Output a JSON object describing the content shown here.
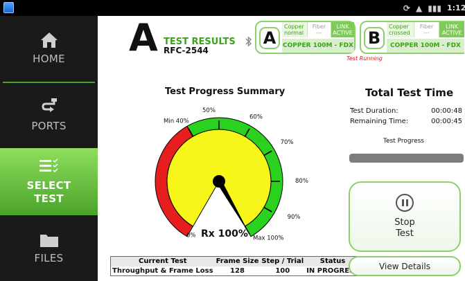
{
  "statusbar": {
    "time": "1:12"
  },
  "sidebar": {
    "items": [
      {
        "label": "HOME",
        "icon": "home-icon"
      },
      {
        "label": "PORTS",
        "icon": "ports-icon"
      },
      {
        "label": "SELECT\nTEST",
        "label_line1": "SELECT",
        "label_line2": "TEST",
        "icon": "list-check-icon",
        "selected": true
      },
      {
        "label": "FILES",
        "icon": "folder-icon"
      }
    ]
  },
  "header": {
    "letter": "A",
    "title": "TEST RESULTS",
    "subtitle": "RFC-2544",
    "test_running": "Test Running"
  },
  "ports": [
    {
      "letter": "A",
      "copper": "Copper",
      "copper_sub": "normal",
      "fiber": "Fiber",
      "fiber_sub": "---",
      "link": "LINK",
      "link_sub": "ACTIVE",
      "speed": "COPPER 100M  - FDX"
    },
    {
      "letter": "B",
      "copper": "Copper",
      "copper_sub": "crossed",
      "fiber": "Fiber",
      "fiber_sub": "---",
      "link": "LINK",
      "link_sub": "ACTIVE",
      "speed": "COPPER 100M  - FDX"
    }
  ],
  "gauge": {
    "title": "Test Progress Summary",
    "value_percent": 100,
    "value_label": "Rx 100%",
    "ticks": [
      "0%",
      "Min 40%",
      "50%",
      "60%",
      "70%",
      "80%",
      "90%",
      "Max 100%"
    ],
    "colors": {
      "red": "#e61e1e",
      "green": "#2bd11f",
      "yellow": "#f6f61a"
    }
  },
  "table": {
    "headers": [
      "Current Test",
      "Frame Size",
      "Step / Trial",
      "Status"
    ],
    "row": [
      "Throughput & Frame Loss",
      "128",
      "100",
      "IN PROGRESS"
    ]
  },
  "time": {
    "title": "Total Test Time",
    "duration_label": "Test Duration:",
    "duration": "00:00:48",
    "remaining_label": "Remaining Time:",
    "remaining": "00:00:45",
    "progress_label": "Test Progress",
    "progress_fraction": 0.0
  },
  "buttons": {
    "stop_line1": "Stop",
    "stop_line2": "Test",
    "details": "View Details"
  }
}
